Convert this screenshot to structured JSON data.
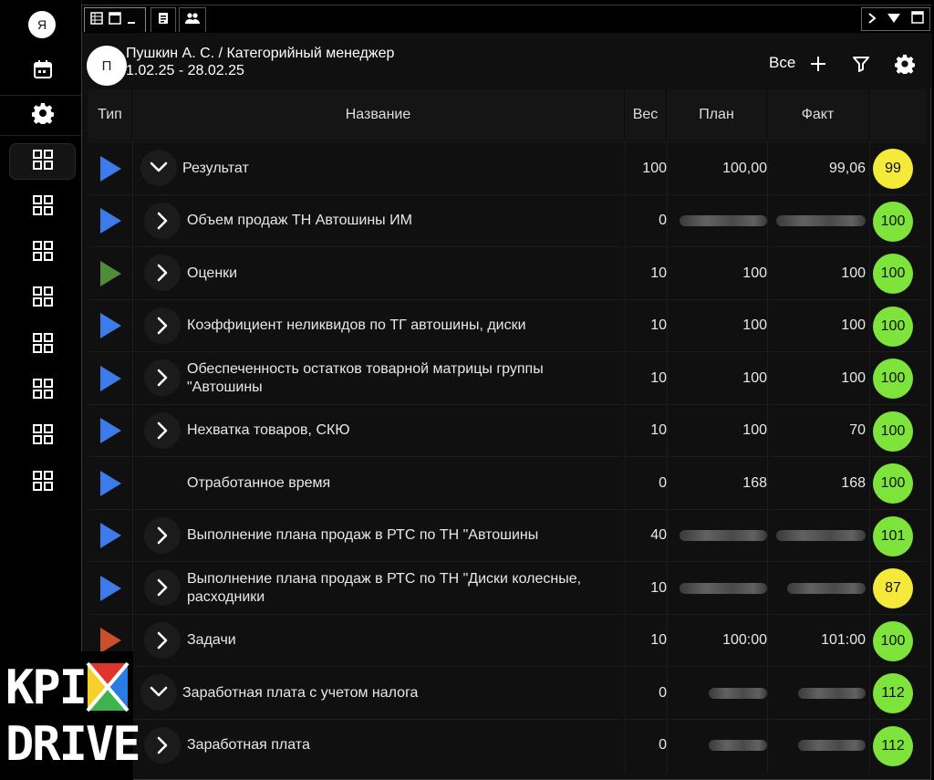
{
  "sidebar": {
    "avatar_letter": "Я",
    "icons": [
      "calendar-icon",
      "gear-icon",
      "grid-icon",
      "grid-icon",
      "grid-icon",
      "grid-icon",
      "grid-icon",
      "grid-icon",
      "grid-icon",
      "grid-icon"
    ]
  },
  "tabs": {
    "controls": [
      "table-icon",
      "window-icon",
      "minimize-icon",
      "document-icon",
      "users-icon"
    ],
    "window_controls": [
      "chevron-right-icon",
      "triangle-down-icon",
      "maximize-icon"
    ]
  },
  "header": {
    "avatar_letter": "П",
    "title": "Пушкин А. С. / Категорийный менеджер",
    "date_range": "1.02.25 - 28.02.25",
    "filter_label": "Все"
  },
  "table": {
    "columns": {
      "type": "Тип",
      "name": "Название",
      "weight": "Вес",
      "plan": "План",
      "fact": "Факт"
    },
    "rows": [
      {
        "type_color": "#3e7bea",
        "chevron": "down",
        "level": 0,
        "name": "Результат",
        "weight": "100",
        "plan": "100,00",
        "fact": "99,06",
        "score": "99",
        "score_color": "#f5e93a",
        "plan_hidden": false,
        "fact_hidden": false
      },
      {
        "type_color": "#3e7bea",
        "chevron": "right",
        "level": 1,
        "name": "Объем продаж ТН Автошины ИМ",
        "weight": "0",
        "plan": "",
        "fact": "",
        "score": "100",
        "score_color": "#7ee33b",
        "plan_hidden": true,
        "fact_hidden": true
      },
      {
        "type_color": "#4e8c3a",
        "chevron": "right",
        "level": 1,
        "name": "Оценки",
        "weight": "10",
        "plan": "100",
        "fact": "100",
        "score": "100",
        "score_color": "#7ee33b",
        "plan_hidden": false,
        "fact_hidden": false
      },
      {
        "type_color": "#3e7bea",
        "chevron": "right",
        "level": 1,
        "name": "Коэффициент неликвидов по ТГ  автошины, диски",
        "weight": "10",
        "plan": "100",
        "fact": "100",
        "score": "100",
        "score_color": "#7ee33b",
        "plan_hidden": false,
        "fact_hidden": false
      },
      {
        "type_color": "#3e7bea",
        "chevron": "right",
        "level": 1,
        "name": "Обеспеченность остатков товарной матрицы группы \"Автошины",
        "weight": "10",
        "plan": "100",
        "fact": "100",
        "score": "100",
        "score_color": "#7ee33b",
        "plan_hidden": false,
        "fact_hidden": false
      },
      {
        "type_color": "#3e7bea",
        "chevron": "right",
        "level": 1,
        "name": "Нехватка товаров, СКЮ",
        "weight": "10",
        "plan": "100",
        "fact": "70",
        "score": "100",
        "score_color": "#7ee33b",
        "plan_hidden": false,
        "fact_hidden": false
      },
      {
        "type_color": "#3e7bea",
        "chevron": "none",
        "level": 1,
        "name": "Отработанное время",
        "weight": "0",
        "plan": "168",
        "fact": "168",
        "score": "100",
        "score_color": "#7ee33b",
        "plan_hidden": false,
        "fact_hidden": false
      },
      {
        "type_color": "#3e7bea",
        "chevron": "right",
        "level": 1,
        "name": "Выполнение плана продаж в РТС по ТН \"Автошины",
        "weight": "40",
        "plan": "",
        "fact": "",
        "score": "101",
        "score_color": "#7ee33b",
        "plan_hidden": true,
        "fact_hidden": true
      },
      {
        "type_color": "#3e7bea",
        "chevron": "right",
        "level": 1,
        "name": "Выполнение плана продаж в РТС по ТН \"Диски колесные, расходники",
        "weight": "10",
        "plan": "",
        "fact": "",
        "score": "87",
        "score_color": "#f5e93a",
        "plan_hidden": true,
        "fact_hidden": true
      },
      {
        "type_color": "#c9502a",
        "chevron": "right",
        "level": 1,
        "name": "Задачи",
        "weight": "10",
        "plan": "100:00",
        "fact": "101:00",
        "score": "100",
        "score_color": "#7ee33b",
        "plan_hidden": false,
        "fact_hidden": false
      },
      {
        "type_color": "",
        "chevron": "down",
        "level": 0,
        "name": "Заработная плата с учетом налога",
        "weight": "0",
        "plan": "",
        "fact": "",
        "score": "112",
        "score_color": "#7ee33b",
        "plan_hidden": true,
        "fact_hidden": true
      },
      {
        "type_color": "",
        "chevron": "right",
        "level": 1,
        "name": "Заработная плата",
        "weight": "0",
        "plan": "",
        "fact": "",
        "score": "112",
        "score_color": "#7ee33b",
        "plan_hidden": true,
        "fact_hidden": true
      }
    ]
  },
  "logo": {
    "line1": "KPI",
    "line2": "DRIVE"
  }
}
